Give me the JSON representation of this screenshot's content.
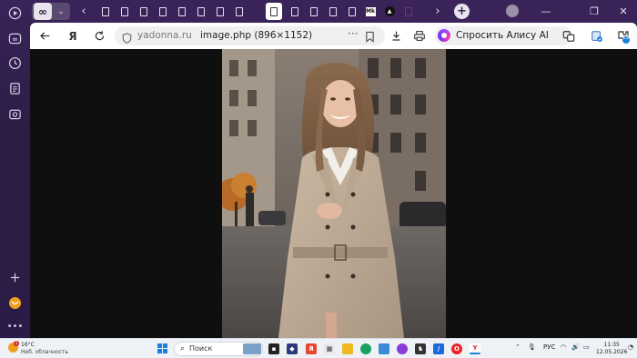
{
  "browser": {
    "url_host": "yadonna.ru",
    "page_title": "image.php (896×1152)",
    "alice_label": "Спросить Алису AI",
    "extension_badge": "13"
  },
  "tabs": [
    {
      "kind": "doc"
    },
    {
      "kind": "doc"
    },
    {
      "kind": "doc"
    },
    {
      "kind": "doc"
    },
    {
      "kind": "doc"
    },
    {
      "kind": "doc"
    },
    {
      "kind": "doc"
    },
    {
      "kind": "doc"
    },
    {
      "kind": "doc",
      "active": true
    },
    {
      "kind": "doc"
    },
    {
      "kind": "doc"
    },
    {
      "kind": "doc"
    },
    {
      "kind": "mk",
      "label": "Mk"
    },
    {
      "kind": "tri"
    },
    {
      "kind": "doc"
    }
  ],
  "taskbar": {
    "weather_temp": "16°C",
    "weather_desc": "Неб. облачность",
    "weather_badge": "1",
    "search_label": "Поиск",
    "lang": "РУС",
    "time": "11:35",
    "date": "12.05.2026"
  },
  "colors": {
    "sidebar": "#2b1d45",
    "tabstrip": "#3a2358",
    "content_bg": "#0f0f10",
    "accent": "#1a7fe0"
  }
}
